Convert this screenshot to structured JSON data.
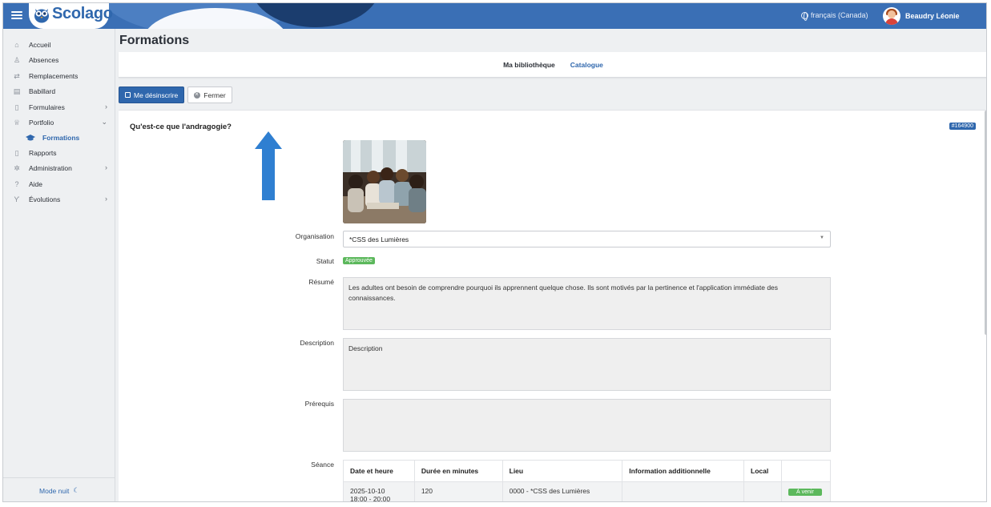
{
  "header": {
    "brand": "Scolago",
    "language": "français (Canada)",
    "user_name": "Beaudry Léonie"
  },
  "sidebar": {
    "items": [
      {
        "label": "Accueil",
        "icon": "home-icon"
      },
      {
        "label": "Absences",
        "icon": "person-absent-icon"
      },
      {
        "label": "Remplacements",
        "icon": "swap-icon"
      },
      {
        "label": "Babillard",
        "icon": "board-icon"
      },
      {
        "label": "Formulaires",
        "icon": "form-icon"
      },
      {
        "label": "Portfolio",
        "icon": "trophy-icon"
      },
      {
        "label": "Formations",
        "icon": "graduation-cap-icon"
      },
      {
        "label": "Rapports",
        "icon": "report-icon"
      },
      {
        "label": "Administration",
        "icon": "gear-icon"
      },
      {
        "label": "Aide",
        "icon": "question-icon"
      },
      {
        "label": "Évolutions",
        "icon": "sprout-icon"
      }
    ],
    "night_mode": "Mode nuit"
  },
  "page": {
    "title": "Formations",
    "tabs": [
      "Ma bibliothèque",
      "Catalogue"
    ],
    "active_tab": "Catalogue"
  },
  "toolbar": {
    "unsubscribe_label": "Me désinscrire",
    "close_label": "Fermer"
  },
  "training": {
    "title": "Qu'est-ce que l'andragogie?",
    "id_badge": "#164900",
    "organisation_label": "Organisation",
    "organisation_value": "*CSS des Lumières",
    "statut_label": "Statut",
    "statut_value": "Approuvée",
    "resume_label": "Résumé",
    "resume_value": "Les adultes ont besoin de comprendre pourquoi ils apprennent quelque chose. Ils sont motivés par la pertinence et l'application immédiate des connaissances.",
    "description_label": "Description",
    "description_value": "Description",
    "prerequis_label": "Prérequis",
    "prerequis_value": "",
    "seance_label": "Séance"
  },
  "sessions": {
    "headers": [
      "Date et heure",
      "Durée en minutes",
      "Lieu",
      "Information additionnelle",
      "Local",
      ""
    ],
    "rows": [
      {
        "date": "2025-10-10",
        "time": "18:00 - 20:00",
        "duration": "120",
        "lieu": "0000 - *CSS des Lumières",
        "info": "",
        "local": "",
        "status": "À venir"
      }
    ]
  },
  "colors": {
    "primary": "#2f67ad",
    "header": "#3a6fb5",
    "success": "#5cb85c"
  }
}
